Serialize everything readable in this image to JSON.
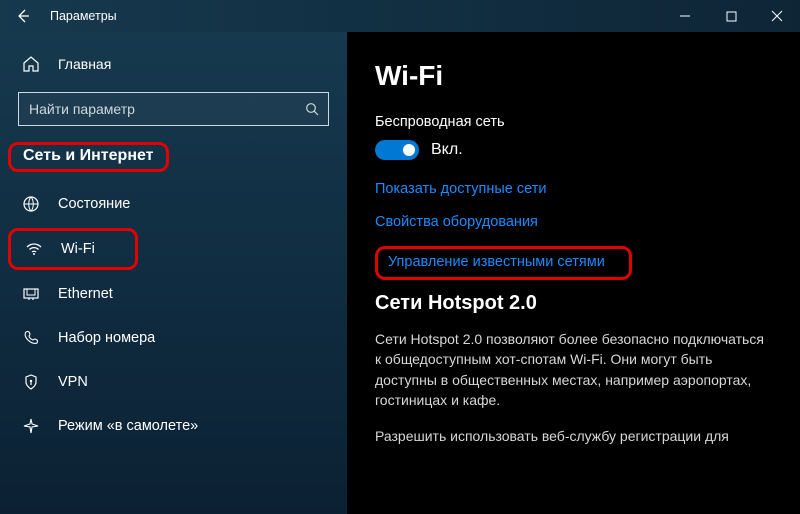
{
  "titlebar": {
    "title": "Параметры"
  },
  "sidebar": {
    "home": "Главная",
    "search_placeholder": "Найти параметр",
    "section": "Сеть и Интернет",
    "items": [
      {
        "label": "Состояние"
      },
      {
        "label": "Wi-Fi"
      },
      {
        "label": "Ethernet"
      },
      {
        "label": "Набор номера"
      },
      {
        "label": "VPN"
      },
      {
        "label": "Режим «в самолете»"
      }
    ]
  },
  "content": {
    "heading": "Wi-Fi",
    "wireless_label": "Беспроводная сеть",
    "toggle_state": "Вкл.",
    "links": {
      "show_networks": "Показать доступные сети",
      "hw_properties": "Свойства оборудования",
      "manage_known": "Управление известными сетями"
    },
    "hotspot_heading": "Сети Hotspot 2.0",
    "hotspot_body": "Сети Hotspot 2.0 позволяют более безопасно подключаться к общедоступным хот-спотам Wi-Fi. Они могут быть доступны в общественных местах, например аэропортах, гостиницах и кафе.",
    "hotspot_body2": "Разрешить использовать веб-службу регистрации для"
  }
}
